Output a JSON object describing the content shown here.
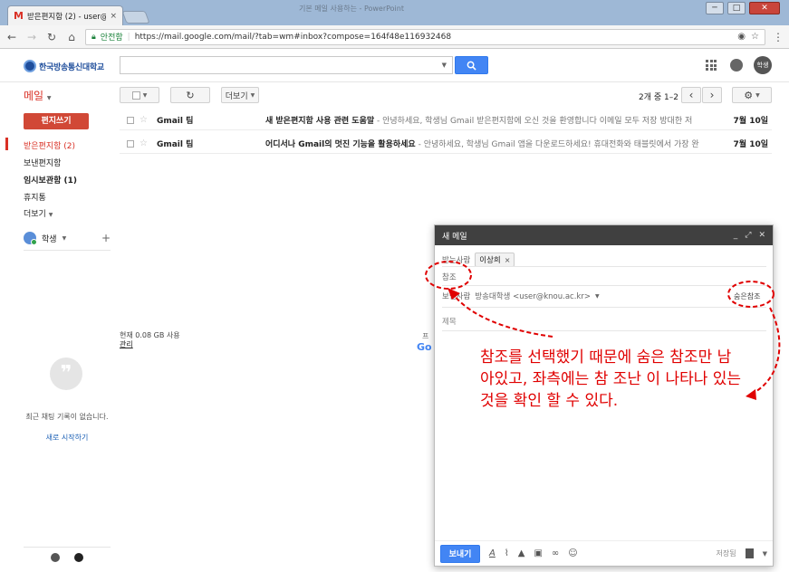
{
  "browser": {
    "tab_title": "받은편지함 (2) - user@k",
    "tab_close": "×",
    "window_title": "기본 메일 사용하는 - PowerPoint",
    "win_min": "─",
    "win_max": "□",
    "win_close": "✕",
    "secure_label": "안전함",
    "url": "https://mail.google.com/mail/?tab=wm#inbox?compose=164f48e116932468"
  },
  "header": {
    "logo_text": "한국방송통신대학교",
    "avatar": "학생"
  },
  "toolbar": {
    "refresh": "↻",
    "more_label": "더보기",
    "page_count": "2개 중 1–2",
    "prev": "‹",
    "next": "›",
    "settings": "⚙"
  },
  "sidebar": {
    "mail_label": "메일",
    "compose_label": "편지쓰기",
    "items": [
      {
        "label": "받은편지함 (2)"
      },
      {
        "label": "보낸편지함"
      },
      {
        "label": "임시보관함 (1)"
      },
      {
        "label": "휴지통"
      },
      {
        "label": "더보기"
      }
    ],
    "user_name": "학생",
    "chat_empty": "최근 채팅 기록이 없습니다.",
    "chat_start": "새로 시작하기"
  },
  "mails": [
    {
      "from": "Gmail 팀",
      "subject": "새 받은편지함 사용 관련 도움말",
      "snippet": " - 안녕하세요, 학생님 Gmail 받은편지함에 오신 것을 환영합니다 이메일 모두 저장 방대한 저",
      "date": "7월 10일"
    },
    {
      "from": "Gmail 팀",
      "subject": "어디서나 Gmail의 멋진 기능을 활용하세요",
      "snippet": " - 안녕하세요, 학생님 Gmail 앱을 다운로드하세요! 휴대전화와 태블릿에서 가장 완",
      "date": "7월 10일"
    }
  ],
  "storage": {
    "usage": "현재 0.08 GB 사용",
    "manage": "관리",
    "policy_fragment": "프",
    "google_fragment": "Go"
  },
  "compose": {
    "title": "새 메일",
    "min": "_",
    "expand": "⤢",
    "close": "✕",
    "to_label": "받는사람",
    "to_chip": "이상희",
    "to_chip_x": "×",
    "cc_label": "참조",
    "from_label": "보낸사람",
    "from_value": "방송대학생 <user@knou.ac.kr>",
    "bcc_link": "숨은참조",
    "subject_placeholder": "제목",
    "send_label": "보내기",
    "saved": "저장됨"
  },
  "annotation": {
    "text": "참조를 선택했기 때문에 숨은 참조만 남아있고, 좌측에는 참 조난 이 나타나 있는 것을 확인 할 수 있다.",
    "color": "#e00000"
  }
}
